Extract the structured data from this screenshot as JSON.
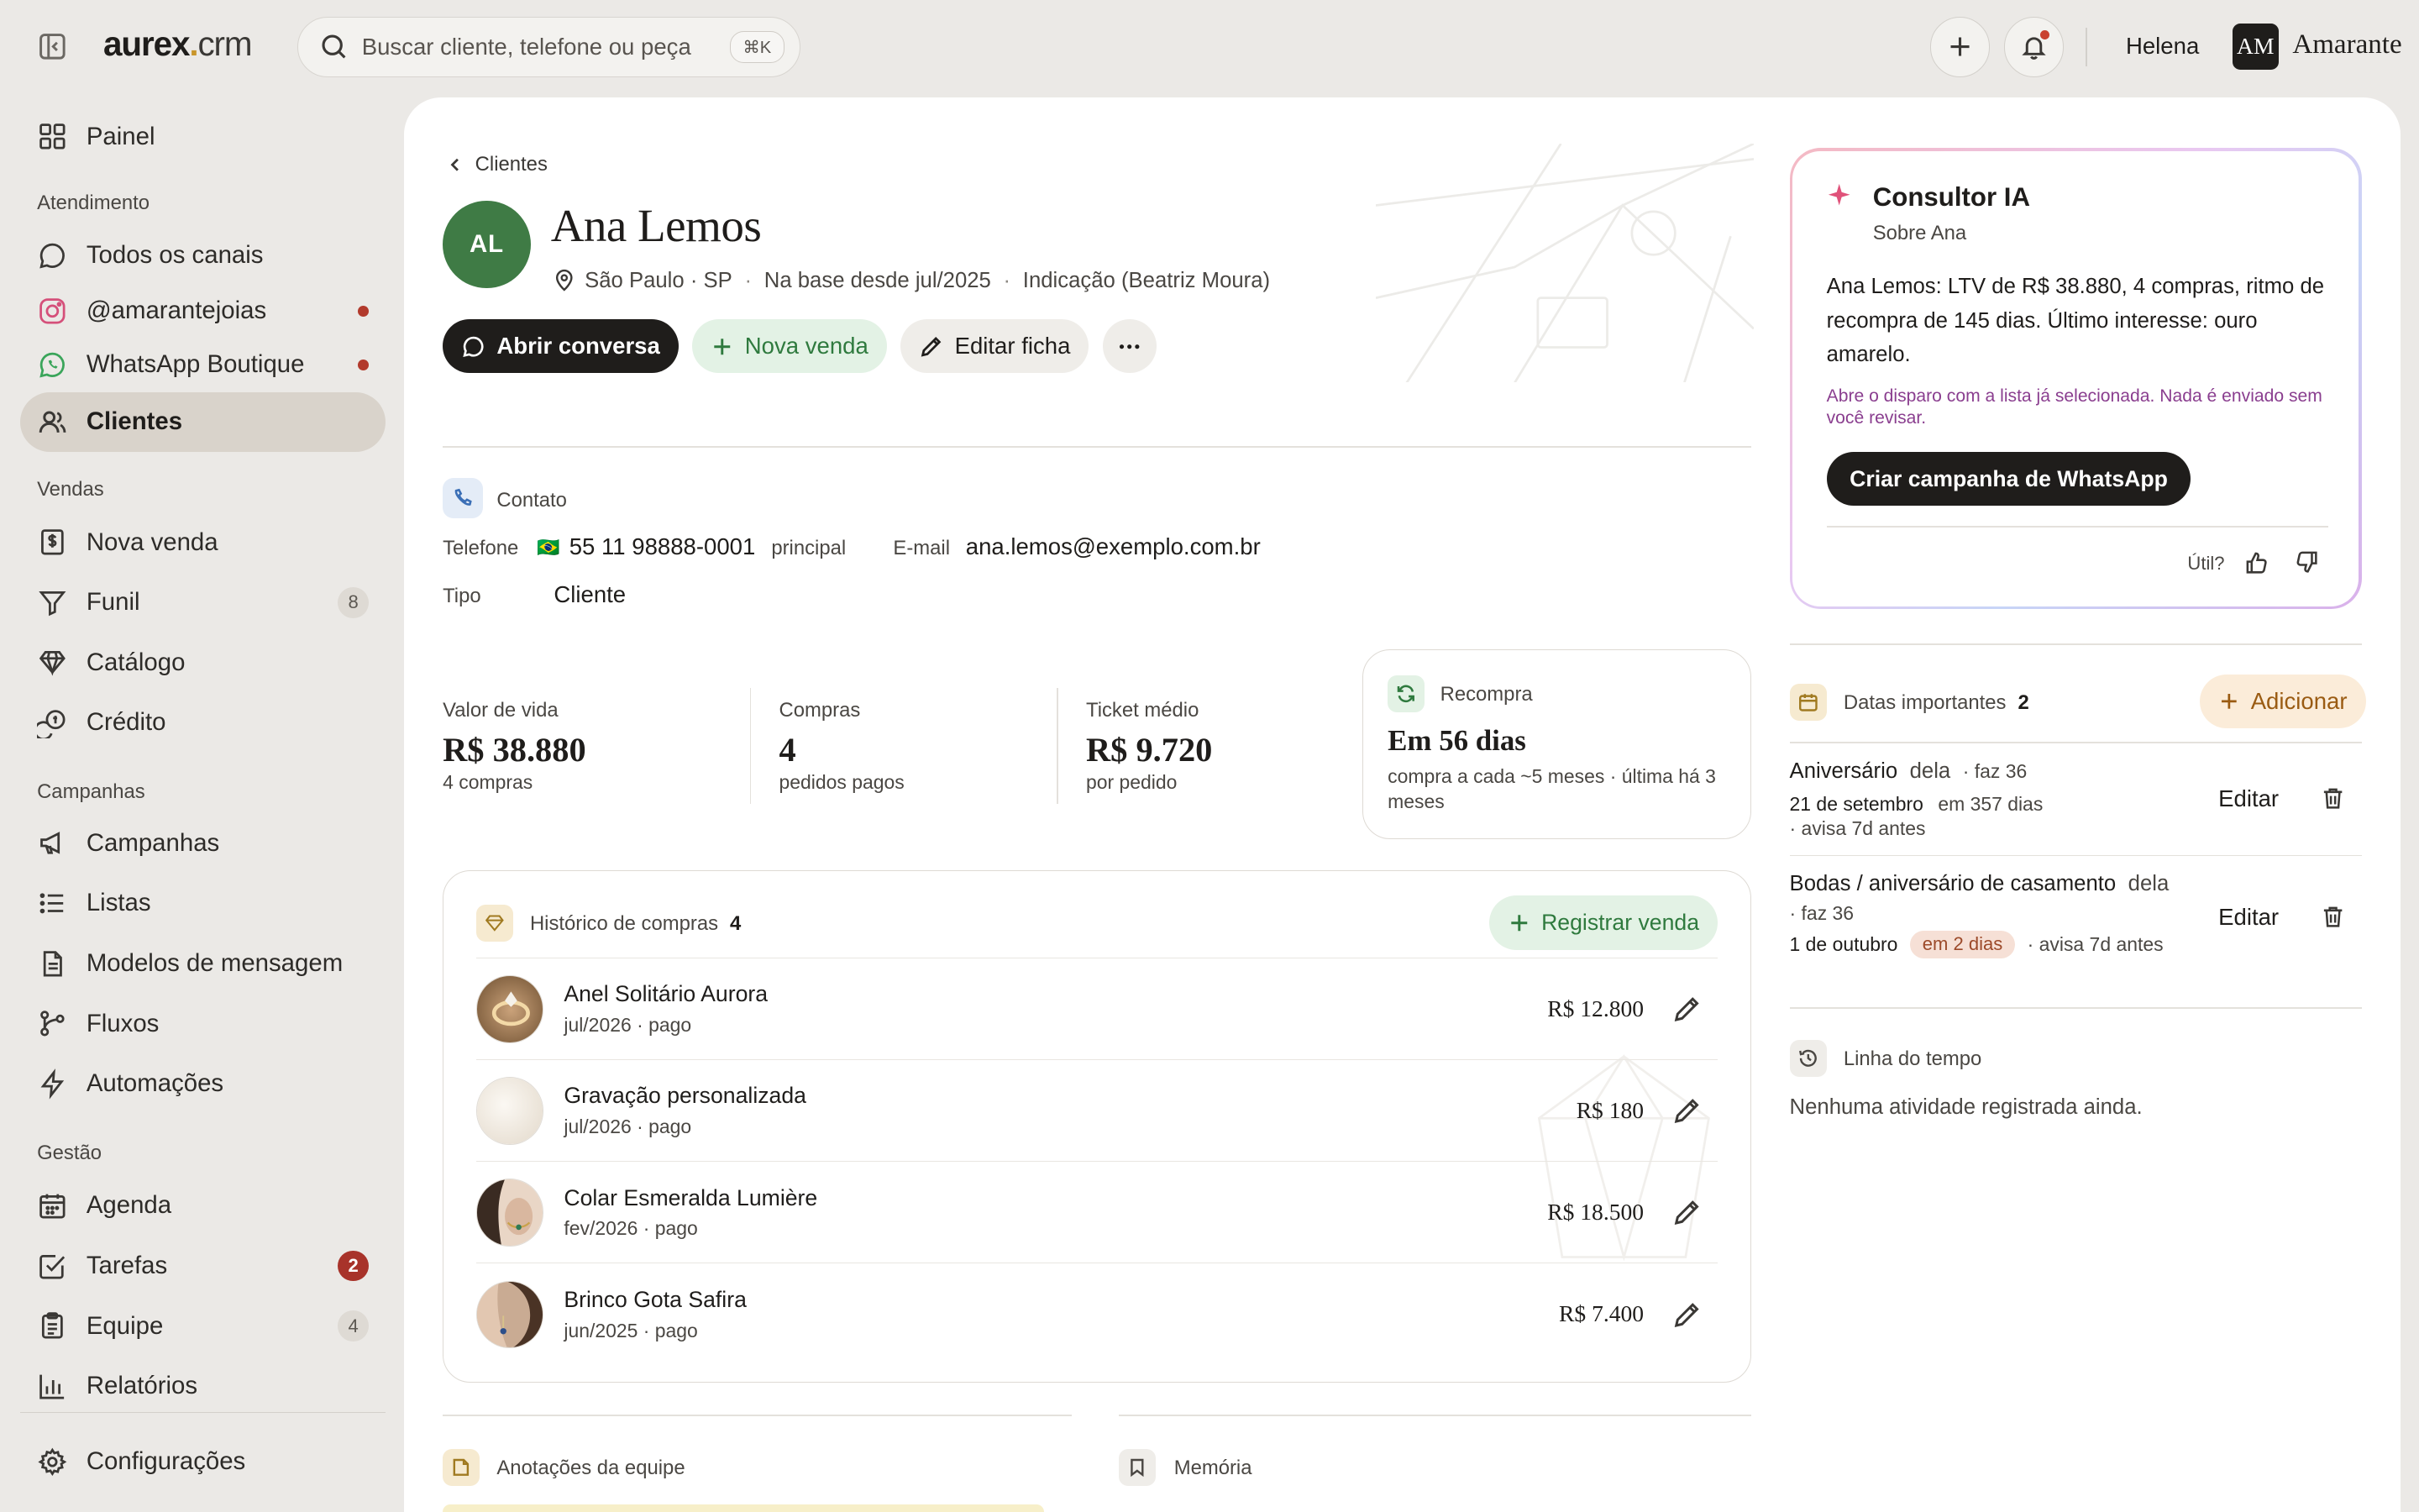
{
  "topbar": {
    "logo_main": "aurex",
    "logo_dot": ".",
    "logo_crm": "crm",
    "search_placeholder": "Buscar cliente, telefone ou peça",
    "search_shortcut": "⌘K",
    "user_name": "Helena",
    "brand_initials": "AM",
    "brand_name": "Amarante",
    "has_notification": true
  },
  "sidebar": {
    "items": [
      {
        "label": "Painel",
        "icon": "grid-icon"
      },
      {
        "label": "Todos os canais",
        "icon": "chat-icon"
      },
      {
        "label": "@amarantejoias",
        "icon": "instagram-icon",
        "dot": true
      },
      {
        "label": "WhatsApp Boutique",
        "icon": "whatsapp-icon",
        "dot": true
      },
      {
        "label": "Clientes",
        "icon": "users-icon",
        "active": true
      },
      {
        "label": "Nova venda",
        "icon": "receipt-icon"
      },
      {
        "label": "Funil",
        "icon": "funnel-icon",
        "count": "8"
      },
      {
        "label": "Catálogo",
        "icon": "diamond-icon"
      },
      {
        "label": "Crédito",
        "icon": "coins-icon"
      },
      {
        "label": "Campanhas",
        "icon": "megaphone-icon"
      },
      {
        "label": "Listas",
        "icon": "list-icon"
      },
      {
        "label": "Modelos de mensagem",
        "icon": "document-icon"
      },
      {
        "label": "Fluxos",
        "icon": "flow-icon"
      },
      {
        "label": "Automações",
        "icon": "bolt-icon"
      },
      {
        "label": "Agenda",
        "icon": "calendar-icon"
      },
      {
        "label": "Tarefas",
        "icon": "checkbox-icon",
        "count": "2"
      },
      {
        "label": "Equipe",
        "icon": "clipboard-icon",
        "count": "4"
      },
      {
        "label": "Relatórios",
        "icon": "bar-chart-icon"
      },
      {
        "label": "Configurações",
        "icon": "gear-icon"
      }
    ],
    "sections": [
      "Atendimento",
      "Vendas",
      "Campanhas",
      "Gestão"
    ]
  },
  "customer": {
    "breadcrumb": "Clientes",
    "initials": "AL",
    "name": "Ana Lemos",
    "location": "São Paulo · SP",
    "since": "Na base desde jul/2025",
    "referral": "Indicação (Beatriz Moura)",
    "actions": {
      "open_chat": "Abrir conversa",
      "new_sale": "Nova venda",
      "edit": "Editar ficha"
    }
  },
  "contact": {
    "title": "Contato",
    "phone_label": "Telefone",
    "phone_flag": "🇧🇷",
    "phone": "55 11 98888-0001",
    "phone_tag": "principal",
    "email_label": "E-mail",
    "email": "ana.lemos@exemplo.com.br",
    "type_label": "Tipo",
    "type_value": "Cliente"
  },
  "stats": {
    "ltv_label": "Valor de vida",
    "ltv_value": "R$ 38.880",
    "ltv_sub": "4 compras",
    "purchases_label": "Compras",
    "purchases_value": "4",
    "purchases_sub": "pedidos pagos",
    "ticket_label": "Ticket médio",
    "ticket_value": "R$ 9.720",
    "ticket_sub": "por pedido",
    "rebuy_label": "Recompra",
    "rebuy_value": "Em 56 dias",
    "rebuy_sub": "compra a cada ~5 meses · última há 3 meses"
  },
  "history": {
    "title": "Histórico de compras",
    "count": "4",
    "add_button": "Registrar venda",
    "rows": [
      {
        "name": "Anel Solitário Aurora",
        "meta": "jul/2026 · pago",
        "price": "R$ 12.800",
        "thumb": "ring"
      },
      {
        "name": "Gravação personalizada",
        "meta": "jul/2026 · pago",
        "price": "R$ 180",
        "thumb": "plain"
      },
      {
        "name": "Colar Esmeralda Lumière",
        "meta": "fev/2026 · pago",
        "price": "R$ 18.500",
        "thumb": "necklace"
      },
      {
        "name": "Brinco Gota Safira",
        "meta": "jun/2025 · pago",
        "price": "R$ 7.400",
        "thumb": "earring"
      }
    ]
  },
  "bottom": {
    "notes_title": "Anotações da equipe",
    "memory_title": "Memória"
  },
  "ai": {
    "title": "Consultor IA",
    "subtitle": "Sobre Ana",
    "body": "Ana Lemos: LTV de R$ 38.880, 4 compras, ritmo de recompra de 145 dias. Último interesse: ouro amarelo.",
    "hint": "Abre o disparo com a lista já selecionada. Nada é enviado sem você revisar.",
    "cta": "Criar campanha de WhatsApp",
    "feedback_label": "Útil?"
  },
  "dates": {
    "title": "Datas importantes",
    "count": "2",
    "add_button": "Adicionar",
    "items": [
      {
        "name": "Aniversário",
        "who": "dela",
        "ago": "· faz 36",
        "date": "21 de setembro",
        "in": "em 357 dias",
        "warn": "",
        "notice": "· avisa 7d antes",
        "edit": "Editar"
      },
      {
        "name": "Bodas / aniversário de casamento",
        "who": "dela",
        "ago": "· faz 36",
        "date": "1 de outubro",
        "in": "",
        "warn": "em 2 dias",
        "notice": "· avisa 7d antes",
        "edit": "Editar"
      }
    ]
  },
  "timeline": {
    "title": "Linha do tempo",
    "empty": "Nenhuma atividade registrada ainda."
  },
  "colors": {
    "accent_dark": "#1f1d1b",
    "avatar_green": "#3f7b45",
    "success_green": "#2f7a3e",
    "alert_red": "#a8332a",
    "brand_gold": "#c9962b"
  }
}
